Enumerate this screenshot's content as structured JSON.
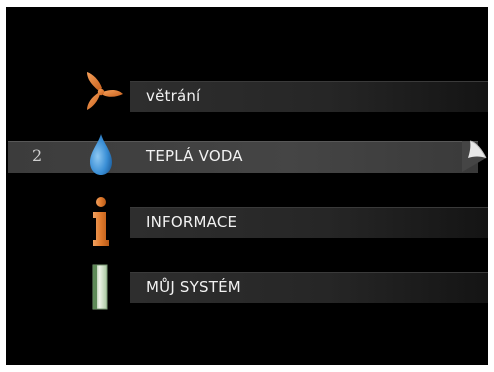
{
  "menu": {
    "items": [
      {
        "label": "větrání",
        "icon": "fan-icon",
        "accent": "#e07a2c",
        "selected": false,
        "index": ""
      },
      {
        "label": "TEPLÁ VODA",
        "icon": "water-drop-icon",
        "accent": "#3a8fd6",
        "selected": true,
        "index": "2"
      },
      {
        "label": "INFORMACE",
        "icon": "info-icon",
        "accent": "#e07a2c",
        "selected": false,
        "index": ""
      },
      {
        "label": "MŮJ SYSTÉM",
        "icon": "system-panel-icon",
        "accent": "#a8c8a0",
        "selected": false,
        "index": ""
      }
    ]
  }
}
